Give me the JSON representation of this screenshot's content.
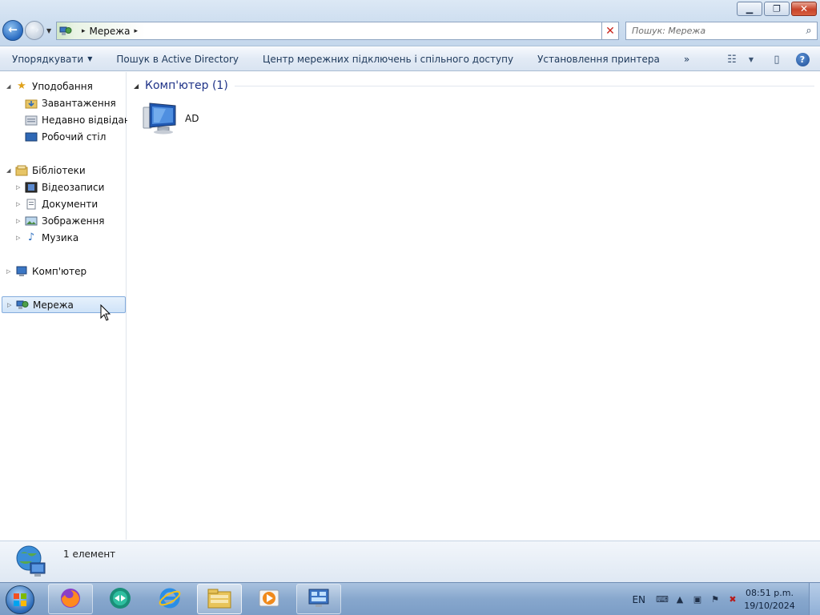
{
  "window": {
    "controls": {
      "minimize": "▁",
      "restore": "❐",
      "close": "✕"
    }
  },
  "address_bar": {
    "crumbs": [
      "Мережа"
    ],
    "separator": "▸",
    "dropdown_glyph": "▾"
  },
  "search": {
    "placeholder": "Пошук: Мережа",
    "icon": "search-icon"
  },
  "command_bar": {
    "organize": "Упорядкувати",
    "search_ad": "Пошук в Active Directory",
    "network_center": "Центр мережних підключень і спільного доступу",
    "add_printer": "Установлення принтера",
    "overflow": "»"
  },
  "nav": {
    "favorites": {
      "label": "Уподобання",
      "items": [
        "Завантаження",
        "Недавно відвідане",
        "Робочий стіл"
      ]
    },
    "libraries": {
      "label": "Бібліотеки",
      "items": [
        "Відеозаписи",
        "Документи",
        "Зображення",
        "Музика"
      ]
    },
    "computer": "Комп'ютер",
    "network": "Мережа"
  },
  "content": {
    "group_label": "Комп'ютер (1)",
    "items": [
      {
        "name": "AD",
        "icon": "computer-icon"
      }
    ]
  },
  "details": {
    "count": "1 елемент"
  },
  "taskbar": {
    "apps": [
      "windows-start",
      "firefox",
      "teamviewer",
      "internet-explorer",
      "windows-explorer",
      "media-player",
      "control-panel"
    ],
    "language": "EN",
    "time": "08:51 p.m.",
    "date": "19/10/2024"
  },
  "colors": {
    "accent": "#1e3287",
    "titlebar": "#cfdff0",
    "taskbar": "#87a7cd",
    "selection": "#cfe3f8"
  }
}
